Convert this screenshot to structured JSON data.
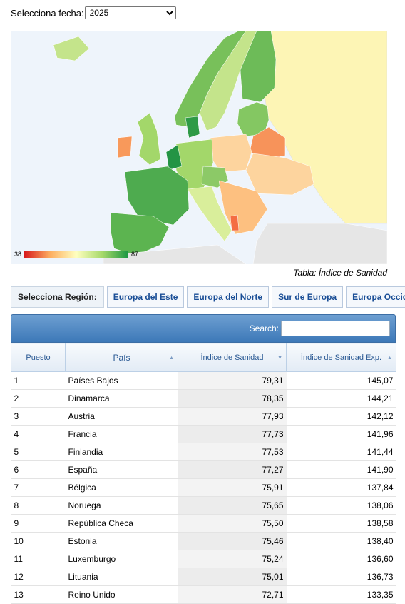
{
  "date_selector": {
    "label": "Selecciona fecha:",
    "value": "2025"
  },
  "map": {
    "legend_min": "38",
    "legend_max": "87",
    "caption": "Tabla: Índice de Sanidad",
    "colors": {
      "high": "#1a9641",
      "mid_high": "#a6d96a",
      "mid": "#ffffbf",
      "mid_low": "#fdae61",
      "low": "#d7191c",
      "no_data": "#e6e6e6",
      "sea": "#eef4fb"
    }
  },
  "regions": {
    "label": "Selecciona Región:",
    "buttons": [
      "Europa del Este",
      "Europa del Norte",
      "Sur de Europa",
      "Europa Occid"
    ]
  },
  "table": {
    "search_label": "Search:",
    "search_value": "",
    "headers": [
      "Puesto",
      "País",
      "Índice de Sanidad",
      "Índice de Sanidad Exp."
    ],
    "rows": [
      [
        "1",
        "Países Bajos",
        "79,31",
        "145,07"
      ],
      [
        "2",
        "Dinamarca",
        "78,35",
        "144,21"
      ],
      [
        "3",
        "Austria",
        "77,93",
        "142,12"
      ],
      [
        "4",
        "Francia",
        "77,73",
        "141,96"
      ],
      [
        "5",
        "Finlandia",
        "77,53",
        "141,44"
      ],
      [
        "6",
        "España",
        "77,27",
        "141,90"
      ],
      [
        "7",
        "Bélgica",
        "75,91",
        "137,84"
      ],
      [
        "8",
        "Noruega",
        "75,65",
        "138,06"
      ],
      [
        "9",
        "República Checa",
        "75,50",
        "138,58"
      ],
      [
        "10",
        "Estonia",
        "75,46",
        "138,40"
      ],
      [
        "11",
        "Luxemburgo",
        "75,24",
        "136,60"
      ],
      [
        "12",
        "Lituania",
        "75,01",
        "136,73"
      ],
      [
        "13",
        "Reino Unido",
        "72,71",
        "133,35"
      ]
    ]
  }
}
